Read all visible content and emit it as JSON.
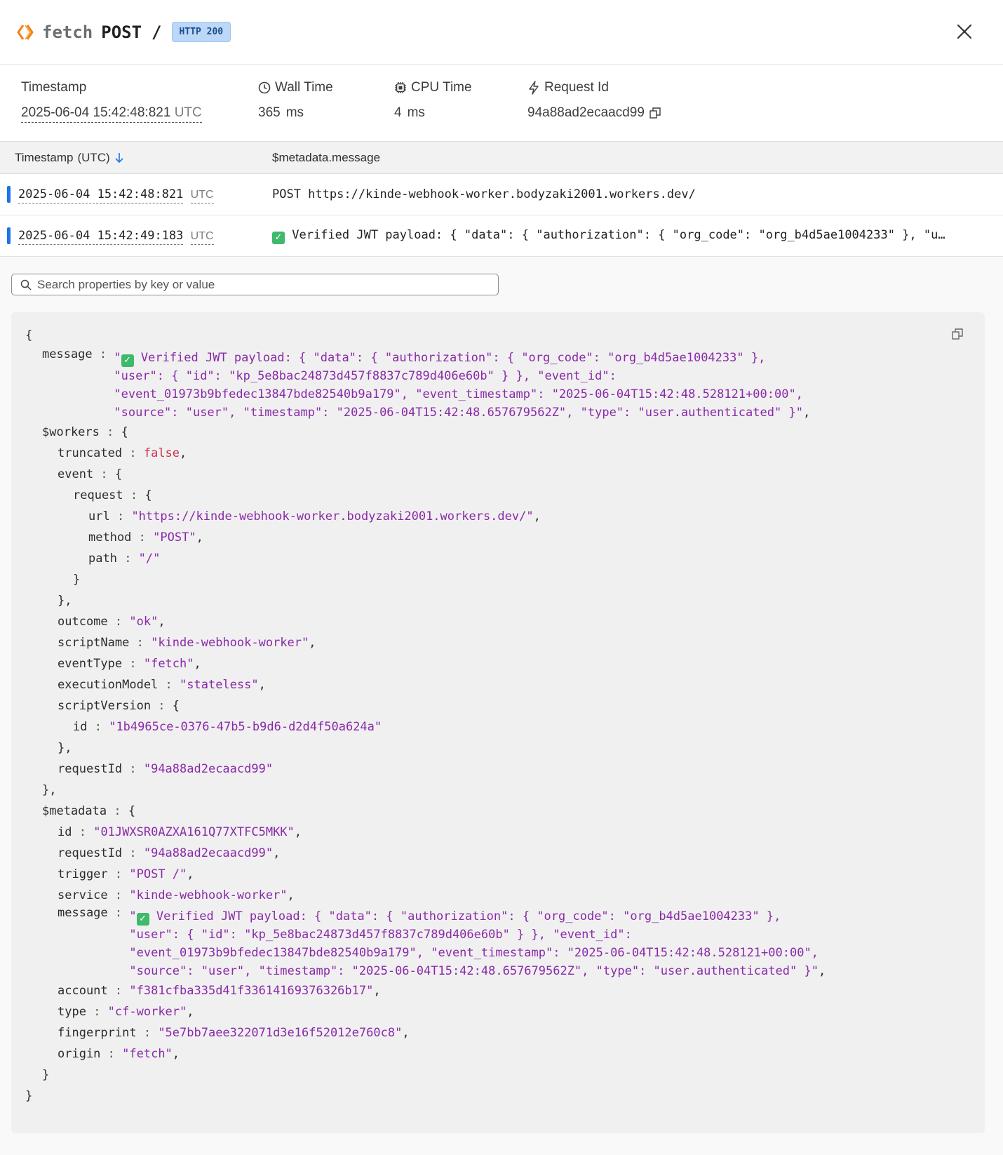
{
  "header": {
    "event": "fetch",
    "method": "POST",
    "path": "/",
    "badge": "HTTP 200",
    "icon": "workers-logo-icon"
  },
  "summary": {
    "timestamp_label": "Timestamp",
    "timestamp_value": "2025-06-04 15:42:48:821",
    "timestamp_tz": "UTC",
    "wall_label": "Wall Time",
    "wall_value": "365",
    "wall_unit": "ms",
    "cpu_label": "CPU Time",
    "cpu_value": "4",
    "cpu_unit": "ms",
    "rid_label": "Request Id",
    "rid_value": "94a88ad2ecaacd99"
  },
  "table": {
    "col_ts": "Timestamp",
    "col_ts_sub": "(UTC)",
    "col_msg": "$metadata.message",
    "rows": [
      {
        "ts": "2025-06-04 15:42:48:821",
        "tz": "UTC",
        "msg": "POST https://kinde-webhook-worker.bodyzaki2001.workers.dev/"
      },
      {
        "ts": "2025-06-04 15:42:49:183",
        "tz": "UTC",
        "msg": " Verified JWT payload: { \"data\": { \"authorization\": { \"org_code\": \"org_b4d5ae1004233\" }, \"u…"
      }
    ]
  },
  "search": {
    "placeholder": "Search properties by key or value"
  },
  "json": {
    "message_text": "Verified JWT payload: { \"data\": { \"authorization\": { \"org_code\": \"org_b4d5ae1004233\" }, \"user\": { \"id\": \"kp_5e8bac24873d457f8837c789d406e60b\" } }, \"event_id\": \"event_01973b9bfedec13847bde82540b9a179\", \"event_timestamp\": \"2025-06-04T15:42:48.528121+00:00\", \"source\": \"user\", \"timestamp\": \"2025-06-04T15:42:48.657679562Z\", \"type\": \"user.authenticated\" }",
    "truncated": "false",
    "url": "\"https://kinde-webhook-worker.bodyzaki2001.workers.dev/\"",
    "method": "\"POST\"",
    "path": "\"/\"",
    "outcome": "\"ok\"",
    "scriptName": "\"kinde-webhook-worker\"",
    "eventType": "\"fetch\"",
    "executionModel": "\"stateless\"",
    "scriptVersion_id": "\"1b4965ce-0376-47b5-b9d6-d2d4f50a624a\"",
    "requestId": "\"94a88ad2ecaacd99\"",
    "meta_id": "\"01JWXSR0AZXA161Q77XTFC5MKK\"",
    "meta_requestId": "\"94a88ad2ecaacd99\"",
    "trigger": "\"POST /\"",
    "service": "\"kinde-webhook-worker\"",
    "account": "\"f381cfba335d41f33614169376326b17\"",
    "type": "\"cf-worker\"",
    "fingerprint": "\"5e7bb7aee322071d3e16f52012e760c8\"",
    "origin": "\"fetch\""
  }
}
